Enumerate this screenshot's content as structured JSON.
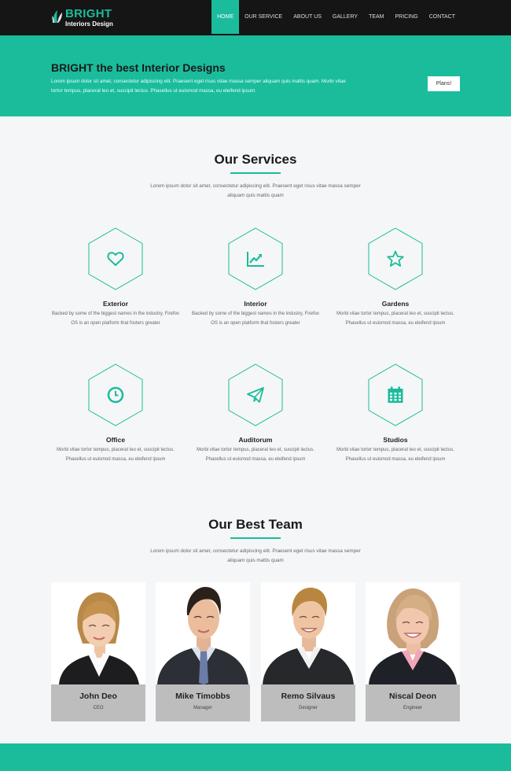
{
  "brand": {
    "name": "BRIGHT",
    "tagline": "Interiors Design"
  },
  "nav": {
    "items": [
      "HOME",
      "OUR SERVICE",
      "ABOUT US",
      "GALLERY",
      "TEAM",
      "PRICING",
      "CONTACT"
    ],
    "active": "HOME"
  },
  "hero": {
    "title": "BRIGHT the best Interior Designs",
    "text": "Lorem ipsum dolor sit amet, consectetur adipiscing elit. Praesent eget risus vitae massa semper aliquam quis mattis quam. Morbi vitae tortor tempus, placerat leo et, suscipit lectus. Phasellus ut euismod massa, eu eleifend ipsum.",
    "button": "Plans!"
  },
  "services": {
    "title": "Our Services",
    "subtitle": "Lorem ipsum dolor sit amet, consectetur adipiscing elit. Praesent eget risus vitae massa semper aliquam quis mattis quam",
    "items": [
      {
        "name": "Exterior",
        "icon": "heart-icon",
        "desc": "Backed by some of the biggest names in the industry, Firefox OS is an open platform that fosters greater"
      },
      {
        "name": "Interior",
        "icon": "chart-icon",
        "desc": "Backed by some of the biggest names in the industry, Firefox OS is an open platform that fosters greater"
      },
      {
        "name": "Gardens",
        "icon": "star-icon",
        "desc": "Morbi vitae tortor tempus, placerat leo et, suscipit lectus. Phasellus ut euismod massa, eu eleifend ipsum"
      },
      {
        "name": "Office",
        "icon": "clock-icon",
        "desc": "Morbi vitae tortor tempus, placerat leo et, suscipit lectus. Phasellus ut euismod massa, eu eleifend ipsum"
      },
      {
        "name": "Auditorum",
        "icon": "paper-plane-icon",
        "desc": "Morbi vitae tortor tempus, placerat leo et, suscipit lectus. Phasellus ut euismod massa, eu eleifend ipsum"
      },
      {
        "name": "Studios",
        "icon": "calendar-icon",
        "desc": "Morbi vitae tortor tempus, placerat leo et, suscipit lectus. Phasellus ut euismod massa, eu eleifend ipsum"
      }
    ]
  },
  "team": {
    "title": "Our Best Team",
    "subtitle": "Lorem ipsum dolor sit amet, consectetur adipiscing elit. Praesent eget risus vitae massa semper aliquam quis mattis quam",
    "members": [
      {
        "name": "John Deo",
        "role": "CEO"
      },
      {
        "name": "Mike Timobbs",
        "role": "Manager"
      },
      {
        "name": "Remo Silvaus",
        "role": "Designer"
      },
      {
        "name": "Niscal Deon",
        "role": "Engineer"
      }
    ]
  },
  "colors": {
    "accent": "#1abc9c",
    "nav_bg": "#151515",
    "plate_bg": "#bdbdbd",
    "page_bg": "#f5f6f7"
  }
}
